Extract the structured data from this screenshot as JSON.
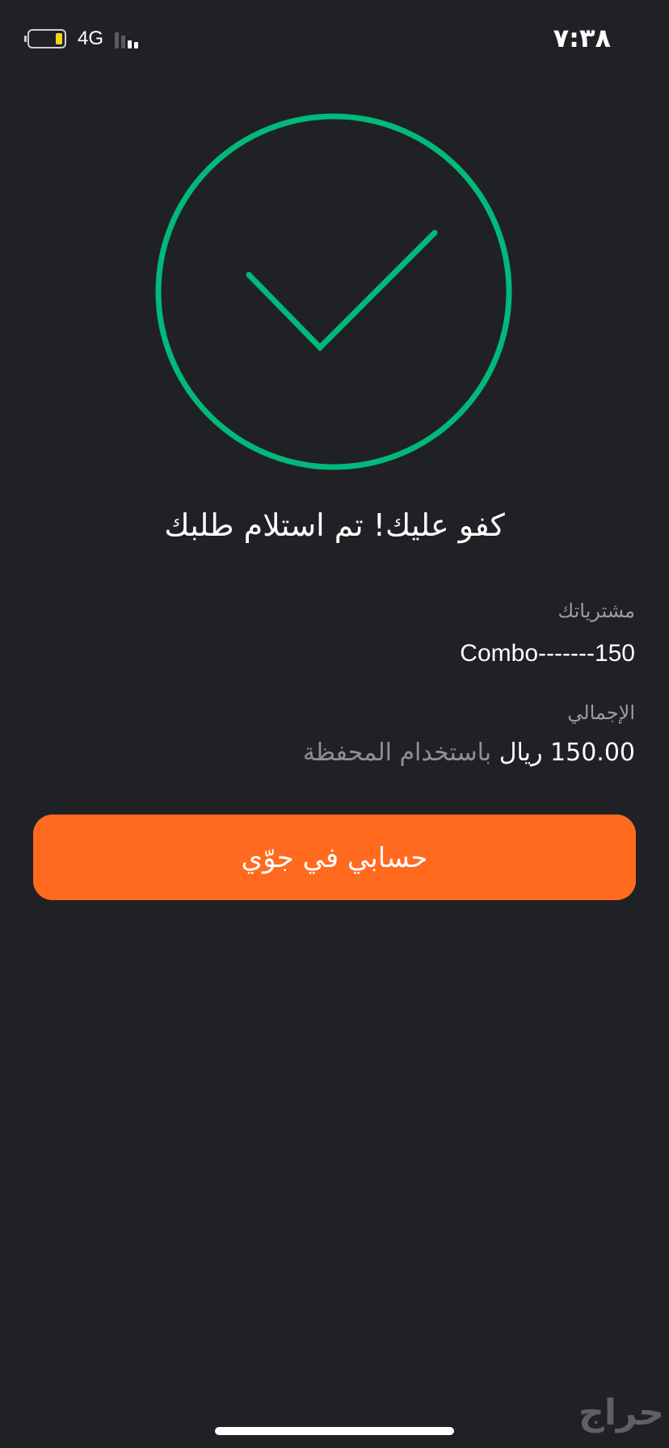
{
  "status_bar": {
    "time": "٧:٣٨",
    "network": "4G",
    "battery_level": 0.2,
    "battery_color": "#F2D21B"
  },
  "confirmation": {
    "icon": "checkmark-circle-icon",
    "accent_color": "#00B97A",
    "title": "كفو عليك! تم استلام طلبك"
  },
  "summary": {
    "purchases_label": "مشترياتك",
    "purchases_value": "Combo-------150",
    "total_label": "الإجمالي",
    "total_amount": "150.00 ريال",
    "payment_method": "باستخدام المحفظة"
  },
  "actions": {
    "my_account_button": "حسابي في جوّي",
    "button_color": "#FF6A1F"
  },
  "watermark": {
    "text": "حراج"
  }
}
